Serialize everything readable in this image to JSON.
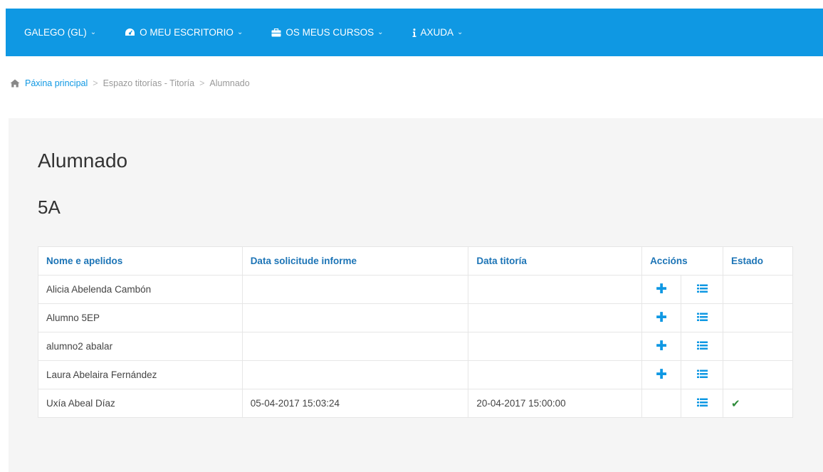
{
  "navbar": {
    "items": [
      {
        "label": "GALEGO (GL)",
        "icon": "none"
      },
      {
        "label": "O MEU ESCRITORIO",
        "icon": "tachometer-icon"
      },
      {
        "label": "OS MEUS CURSOS",
        "icon": "briefcase-icon"
      },
      {
        "label": "AXUDA",
        "icon": "info-icon"
      }
    ],
    "caret": "⌄",
    "color": "#0f98e3"
  },
  "breadcrumb": {
    "home": "Páxina principal",
    "items": [
      "Espazo titorías - Titoría",
      "Alumnado"
    ],
    "separator": ">"
  },
  "main": {
    "title": "Alumnado",
    "group": "5A"
  },
  "table": {
    "headers": [
      "Nome e apelidos",
      "Data solicitude informe",
      "Data titoría",
      "Accións",
      "Estado"
    ],
    "rows": [
      {
        "name": "Alicia Abelenda Cambón",
        "request_date": "",
        "tutoring_date": "",
        "can_add": true,
        "done": false
      },
      {
        "name": "Alumno 5EP",
        "request_date": "",
        "tutoring_date": "",
        "can_add": true,
        "done": false
      },
      {
        "name": "alumno2 abalar",
        "request_date": "",
        "tutoring_date": "",
        "can_add": true,
        "done": false
      },
      {
        "name": "Laura Abelaira Fernández",
        "request_date": "",
        "tutoring_date": "",
        "can_add": true,
        "done": false
      },
      {
        "name": "Uxía Abeal Díaz",
        "request_date": "05-04-2017 15:03:24",
        "tutoring_date": "20-04-2017 15:00:00",
        "can_add": false,
        "done": true
      }
    ],
    "add_glyph": "✚",
    "done_glyph": "✔"
  }
}
